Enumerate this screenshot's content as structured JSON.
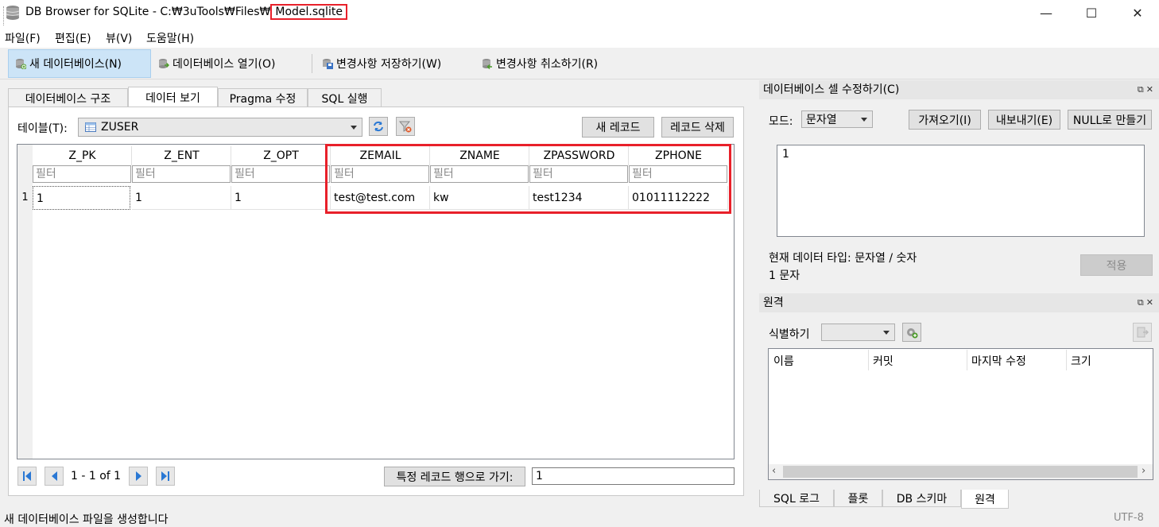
{
  "window": {
    "title_prefix": "DB Browser for SQLite - C:₩3uTools₩Files₩",
    "title_file": "Model.sqlite",
    "minimize": "—",
    "maximize": "☐",
    "close": "✕"
  },
  "menu": [
    "파일(F)",
    "편집(E)",
    "뷰(V)",
    "도움말(H)"
  ],
  "toolbar": {
    "new_db": "새 데이터베이스(N)",
    "open_db": "데이터베이스 열기(O)",
    "write_changes": "변경사항 저장하기(W)",
    "revert_changes": "변경사항 취소하기(R)"
  },
  "tabs": [
    "데이터베이스 구조",
    "데이터 보기",
    "Pragma 수정",
    "SQL 실행"
  ],
  "browse": {
    "table_label": "테이블(T):",
    "table_selected": "ZUSER",
    "new_record": "새 레코드",
    "delete_record": "레코드 삭제",
    "filter_placeholder": "필터",
    "columns": [
      "Z_PK",
      "Z_ENT",
      "Z_OPT",
      "ZEMAIL",
      "ZNAME",
      "ZPASSWORD",
      "ZPHONE"
    ],
    "rows": [
      {
        "row_num": "1",
        "cells": [
          "1",
          "1",
          "1",
          "test@test.com",
          "kw",
          "test1234",
          "01011112222"
        ]
      }
    ],
    "record_count": "1 - 1 of 1",
    "goto_label": "특정 레코드 행으로 가기:",
    "goto_value": "1"
  },
  "edit_cell": {
    "title": "데이터베이스 셀 수정하기(C)",
    "mode_label": "모드:",
    "mode_value": "문자열",
    "import": "가져오기(I)",
    "export": "내보내기(E)",
    "set_null": "NULL로 만들기",
    "content": "1",
    "type_info": "현재 데이터 타입: 문자열 / 숫자",
    "size_info": "1 문자",
    "apply": "적용"
  },
  "remote": {
    "title": "원격",
    "identity_label": "식별하기",
    "columns": [
      "이름",
      "커밋",
      "마지막 수정",
      "크기"
    ]
  },
  "bottom_tabs": [
    "SQL 로그",
    "플롯",
    "DB 스키마",
    "원격"
  ],
  "status": {
    "message": "새 데이터베이스 파일을 생성합니다",
    "encoding": "UTF-8"
  },
  "colors": {
    "highlight": "#e8202a",
    "nav_arrow": "#2a78d4"
  }
}
